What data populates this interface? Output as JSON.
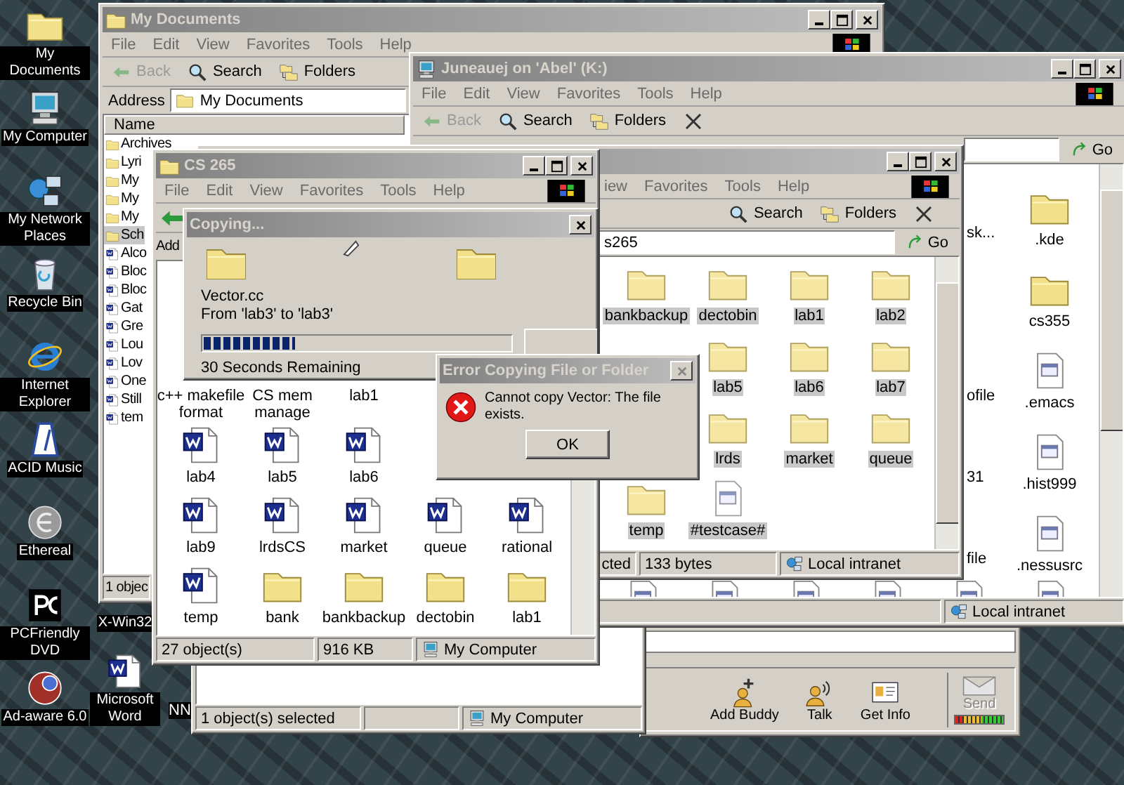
{
  "desktop_icons": [
    {
      "label": "My Documents",
      "kind": "folder"
    },
    {
      "label": "My Computer",
      "kind": "computer"
    },
    {
      "label": "My Network Places",
      "kind": "network"
    },
    {
      "label": "Recycle Bin",
      "kind": "bin"
    },
    {
      "label": "Internet Explorer",
      "kind": "ie"
    },
    {
      "label": "ACID Music",
      "kind": "metronome"
    },
    {
      "label": "Ethereal",
      "kind": "ethereal"
    },
    {
      "label": "PCFriendly DVD",
      "kind": "dvd"
    },
    {
      "label": "Ad-aware 6.0",
      "kind": "adaware"
    }
  ],
  "desktop_icons_second_column": [
    {
      "label": "X-Win32"
    },
    {
      "label": "Microsoft Word",
      "kind": "word"
    }
  ],
  "partial_icon_label": "NN",
  "buddy_window": {
    "buttons": [
      {
        "label": "Add Buddy",
        "kind": "add_buddy"
      },
      {
        "label": "Talk",
        "kind": "talk"
      },
      {
        "label": "Get Info",
        "kind": "info"
      }
    ],
    "send": {
      "label": "Send",
      "disabled": true
    },
    "meter": {
      "level": 1
    }
  },
  "explorer_window": {
    "status": "1 object(s) selected",
    "zone": "My Computer"
  },
  "my_documents": {
    "title": "My Documents",
    "menu": [
      "File",
      "Edit",
      "View",
      "Favorites",
      "Tools",
      "Help"
    ],
    "toolbar": [
      {
        "label": "Back",
        "kind": "back",
        "disabled": true
      },
      {
        "label": "Search",
        "kind": "search",
        "disabled": false
      },
      {
        "label": "Folders",
        "kind": "folders",
        "disabled": false
      }
    ],
    "address_label": "Address",
    "address": "My Documents",
    "column_header": "Name",
    "items": [
      {
        "label": "Archives",
        "kind": "folder",
        "selected": false
      },
      {
        "label": "Lyri",
        "kind": "folder",
        "selected": false
      },
      {
        "label": "My",
        "kind": "folder",
        "selected": false
      },
      {
        "label": "My",
        "kind": "folder",
        "selected": false
      },
      {
        "label": "My",
        "kind": "folder",
        "selected": false
      },
      {
        "label": "Sch",
        "kind": "folder",
        "selected": true
      },
      {
        "label": "Alco",
        "kind": "word",
        "selected": false
      },
      {
        "label": "Bloc",
        "kind": "word",
        "selected": false
      },
      {
        "label": "Bloc",
        "kind": "word",
        "selected": false
      },
      {
        "label": "Gat",
        "kind": "word",
        "selected": false
      },
      {
        "label": "Gre",
        "kind": "word",
        "selected": false
      },
      {
        "label": "Lou",
        "kind": "word",
        "selected": false
      },
      {
        "label": "Lov",
        "kind": "word",
        "selected": false
      },
      {
        "label": "One",
        "kind": "word",
        "selected": false
      },
      {
        "label": "Still",
        "kind": "word",
        "selected": false
      },
      {
        "label": "tem",
        "kind": "word",
        "selected": false
      }
    ],
    "status": "1 objec"
  },
  "juneauej_window": {
    "title": "Juneauej on 'Abel' (K:)",
    "menu": [
      "File",
      "Edit",
      "View",
      "Favorites",
      "Tools",
      "Help"
    ],
    "toolbar": [
      {
        "label": "Back",
        "kind": "back",
        "disabled": true
      },
      {
        "label": "Search",
        "kind": "search",
        "disabled": false
      },
      {
        "label": "Folders",
        "kind": "folders",
        "disabled": false
      }
    ],
    "go": "Go",
    "rows": [
      {
        "column_1": "sk...",
        "item": {
          "label": ".kde",
          "kind": "folder"
        }
      },
      {
        "item": {
          "label": "cs355",
          "kind": "folder"
        }
      },
      {
        "column_1": "ofile",
        "item": {
          "label": ".emacs",
          "kind": "text_file"
        }
      },
      {
        "column_1": "31",
        "item": {
          "label": ".hist999",
          "kind": "text_file"
        }
      },
      {
        "column_1": "file",
        "item": {
          "label": ".nessusrc",
          "kind": "text_file"
        }
      }
    ],
    "zone": "Local intranet"
  },
  "cs265_folder_window": {
    "menu": [
      "iew",
      "Favorites",
      "Tools",
      "Help"
    ],
    "toolbar": [
      {
        "label": "Search",
        "kind": "search",
        "disabled": false
      },
      {
        "label": "Folders",
        "kind": "folders",
        "disabled": false
      }
    ],
    "address": "s265",
    "go": "Go",
    "rows": [
      {
        "items": [
          {
            "label": "bankbackup",
            "kind": "folder",
            "selected": true
          },
          {
            "label": "dectobin",
            "kind": "folder",
            "selected": true
          },
          {
            "label": "lab1",
            "kind": "folder",
            "selected": true
          },
          {
            "label": "lab2",
            "kind": "folder",
            "selected": true
          }
        ]
      },
      {
        "items": [
          {
            "label": "lab5",
            "kind": "folder",
            "selected": true
          },
          {
            "label": "lab6",
            "kind": "folder",
            "selected": true
          },
          {
            "label": "lab7",
            "kind": "folder",
            "selected": true
          }
        ]
      },
      {
        "items": [
          {
            "label": "lrds",
            "kind": "folder",
            "selected": true
          },
          {
            "label": "market",
            "kind": "folder",
            "selected": true
          },
          {
            "label": "queue",
            "kind": "folder",
            "selected": true
          }
        ]
      },
      {
        "items": [
          {
            "label": "temp",
            "kind": "folder",
            "selected": true
          },
          {
            "label": "#testcase#",
            "kind": "text_file",
            "selected": true
          }
        ]
      }
    ],
    "status": "cted",
    "size": "133 bytes",
    "zone": "Local intranet"
  },
  "cs265_window": {
    "title": "CS 265",
    "menu": [
      "File",
      "Edit",
      "View",
      "Favorites",
      "Tools",
      "Help"
    ],
    "address_label": "Add",
    "rows": [
      {
        "items": [
          {
            "label": "c++ makefile format",
            "selected": false
          },
          {
            "label": "CS mem manage",
            "selected": false
          },
          {
            "label": "lab1",
            "selected": false
          }
        ]
      },
      {
        "items": [
          {
            "label": "lab4",
            "kind": "word",
            "selected": false
          },
          {
            "label": "lab5",
            "kind": "word",
            "selected": false
          },
          {
            "label": "lab6",
            "kind": "word",
            "selected": false
          }
        ]
      },
      {
        "items": [
          {
            "label": "lab9",
            "kind": "word",
            "selected": false
          },
          {
            "label": "lrdsCS",
            "kind": "word",
            "selected": false
          },
          {
            "label": "market",
            "kind": "word",
            "selected": false
          },
          {
            "label": "queue",
            "kind": "word",
            "selected": false
          },
          {
            "label": "rational",
            "kind": "word",
            "selected": false
          }
        ]
      },
      {
        "items": [
          {
            "label": "temp",
            "kind": "word",
            "selected": false
          },
          {
            "label": "bank",
            "kind": "folder",
            "selected": false
          },
          {
            "label": "bankbackup",
            "kind": "folder",
            "selected": false
          },
          {
            "label": "dectobin",
            "kind": "folder",
            "selected": false
          },
          {
            "label": "lab1",
            "kind": "folder",
            "selected": false
          }
        ]
      }
    ],
    "status": "27 object(s)",
    "size": "916 KB",
    "zone": "My Computer"
  },
  "copying_dialog": {
    "title": "Copying...",
    "file": "Vector.cc",
    "from_to": "From 'lab3' to 'lab3'",
    "progress": {
      "level": 0.3
    },
    "remaining": "30 Seconds Remaining"
  },
  "error_dialog": {
    "title": "Error Copying File or Folder",
    "message": "Cannot copy Vector: The file exists.",
    "ok": "OK"
  }
}
